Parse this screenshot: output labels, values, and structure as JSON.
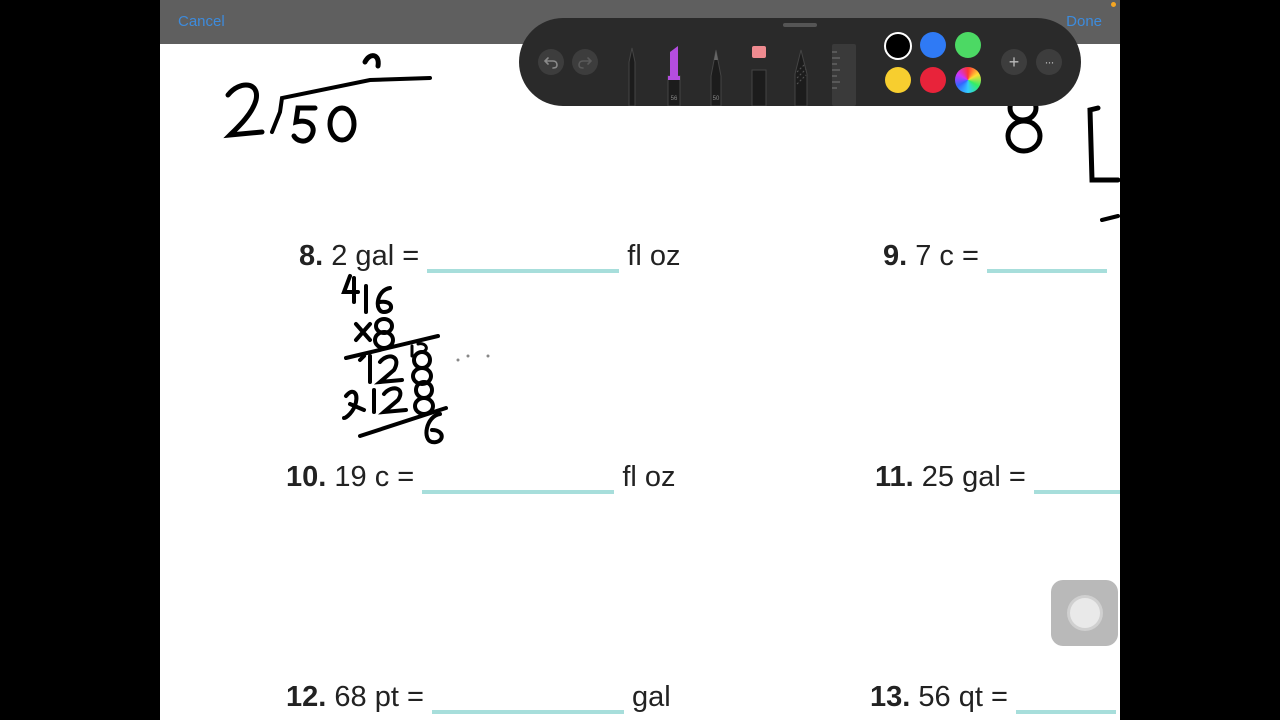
{
  "topbar": {
    "cancel_label": "Cancel",
    "done_label": "Done"
  },
  "palette": {
    "tools": [
      "pen-tool",
      "marker-tool",
      "pencil-tool",
      "eraser-tool",
      "lasso-tool",
      "ruler-tool"
    ],
    "marker_size": "56",
    "pencil_size": "50",
    "colors": {
      "black": "#000000",
      "blue": "#2f7af5",
      "green": "#4cd964",
      "yellow": "#f7ce2f",
      "red": "#e8233a"
    },
    "selected_color": "black",
    "add_label": "+",
    "more_label": "···"
  },
  "worksheet": {
    "problems": [
      {
        "num": "8.",
        "lhs": "2 gal =",
        "unit": "fl oz"
      },
      {
        "num": "9.",
        "lhs": "7 c =",
        "unit": ""
      },
      {
        "num": "10.",
        "lhs": "19 c =",
        "unit": "fl oz"
      },
      {
        "num": "11.",
        "lhs": "25 gal =",
        "unit": ""
      },
      {
        "num": "12.",
        "lhs": "68 pt =",
        "unit": "gal"
      },
      {
        "num": "13.",
        "lhs": "56 qt =",
        "unit": ""
      }
    ],
    "handwriting": {
      "top_left": "2⟌50",
      "top_right": "8",
      "work_problem_8": [
        "4",
        "16",
        "x8",
        "128",
        "2 128",
        "6"
      ]
    }
  }
}
